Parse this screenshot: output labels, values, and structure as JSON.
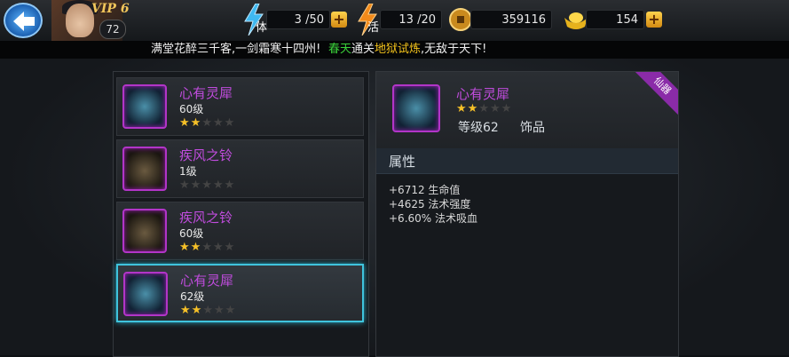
{
  "header": {
    "vip": "VIP 6",
    "level": "72",
    "stamina": {
      "label": "体",
      "value": "3 /50"
    },
    "energy": {
      "label": "活",
      "value": "13 /20"
    },
    "coins": "359116",
    "gold": "154",
    "plus": "+"
  },
  "marquee": {
    "part1": "满堂花醉三千客,一剑霜寒十四州! ",
    "part2": "春天",
    "part3": "通关",
    "part4": "地狱试炼",
    "part5": ",无敌于天下!"
  },
  "colors": {
    "purple": "#c04cdd",
    "star": "#f5c028",
    "green": "#3ad13a",
    "yellow": "#f2c21b",
    "selected": "#3fc4dd"
  },
  "items": [
    {
      "name": "心有灵犀",
      "level": "60级",
      "stars": 2,
      "icon": "amulet-icon"
    },
    {
      "name": "疾风之铃",
      "level": "1级",
      "stars": 0,
      "icon": "bell-icon"
    },
    {
      "name": "疾风之铃",
      "level": "60级",
      "stars": 2,
      "icon": "bell-icon"
    },
    {
      "name": "心有灵犀",
      "level": "62级",
      "stars": 2,
      "icon": "amulet-icon",
      "selected": true
    }
  ],
  "detail": {
    "name": "心有灵犀",
    "stars": 2,
    "level": "等级62",
    "type": "饰品",
    "badge": "仙器",
    "attr_title": "属性",
    "stats": [
      "+6712 生命值",
      "+4625 法术强度",
      "+6.60% 法术吸血"
    ]
  }
}
